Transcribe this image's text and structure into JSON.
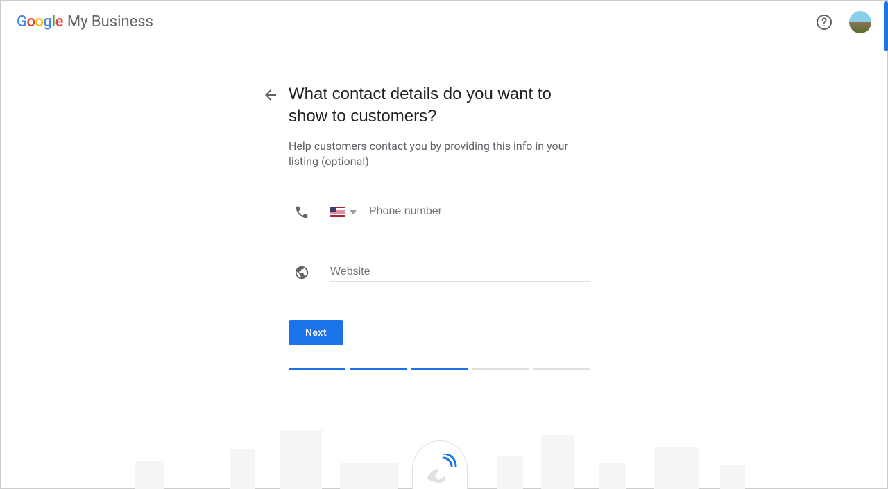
{
  "header": {
    "logo_letters": [
      "G",
      "o",
      "o",
      "g",
      "l",
      "e"
    ],
    "product_name": "My Business"
  },
  "form": {
    "heading": "What contact details do you want to show to customers?",
    "subheading": "Help customers contact you by providing this info in your listing (optional)",
    "phone": {
      "placeholder": "Phone number",
      "value": "",
      "country_code": "US"
    },
    "website": {
      "placeholder": "Website",
      "value": ""
    },
    "next_button": "Next"
  },
  "progress": {
    "completed": 3,
    "total": 5
  }
}
